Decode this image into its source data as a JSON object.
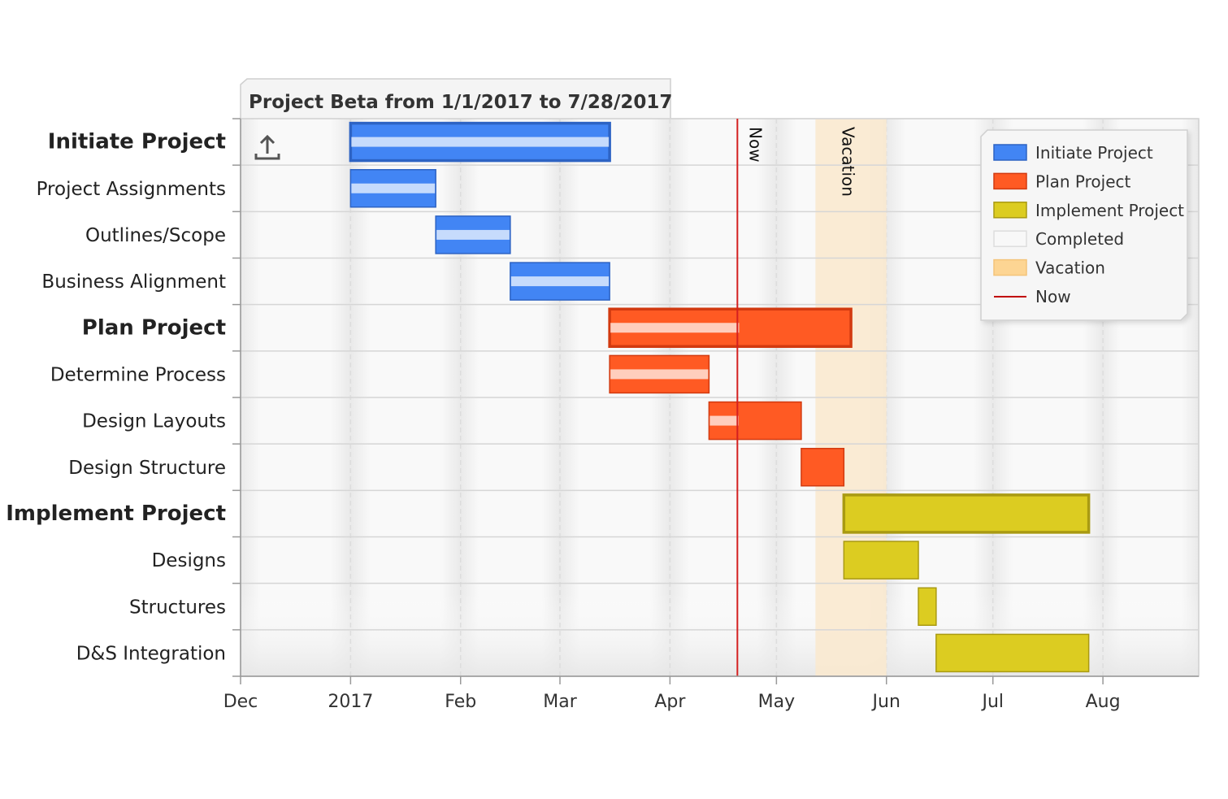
{
  "chart_data": {
    "type": "gantt",
    "title": "Project Beta from 1/1/2017 to 7/28/2017",
    "x_axis": {
      "type": "date",
      "range": [
        "2016-12-01",
        "2017-08-28"
      ],
      "ticks": [
        {
          "date": "2016-12-01",
          "label": "Dec"
        },
        {
          "date": "2017-01-01",
          "label": "2017"
        },
        {
          "date": "2017-02-01",
          "label": "Feb"
        },
        {
          "date": "2017-03-01",
          "label": "Mar"
        },
        {
          "date": "2017-04-01",
          "label": "Apr"
        },
        {
          "date": "2017-05-01",
          "label": "May"
        },
        {
          "date": "2017-06-01",
          "label": "Jun"
        },
        {
          "date": "2017-07-01",
          "label": "Jul"
        },
        {
          "date": "2017-08-01",
          "label": "Aug"
        }
      ],
      "grid": true
    },
    "tasks": [
      {
        "name": "Initiate Project",
        "group": true,
        "series": "Initiate Project",
        "start": "2017-01-01",
        "end": "2017-03-15",
        "completed": 1.0
      },
      {
        "name": "Project Assignments",
        "group": false,
        "series": "Initiate Project",
        "start": "2017-01-01",
        "end": "2017-01-25",
        "completed": 1.0
      },
      {
        "name": "Outlines/Scope",
        "group": false,
        "series": "Initiate Project",
        "start": "2017-01-25",
        "end": "2017-02-15",
        "completed": 1.0
      },
      {
        "name": "Business Alignment",
        "group": false,
        "series": "Initiate Project",
        "start": "2017-02-15",
        "end": "2017-03-15",
        "completed": 1.0
      },
      {
        "name": "Plan Project",
        "group": true,
        "series": "Plan Project",
        "start": "2017-03-15",
        "end": "2017-05-22",
        "completed": 0.54
      },
      {
        "name": "Determine Process",
        "group": false,
        "series": "Plan Project",
        "start": "2017-03-15",
        "end": "2017-04-12",
        "completed": 1.0
      },
      {
        "name": "Design Layouts",
        "group": false,
        "series": "Plan Project",
        "start": "2017-04-12",
        "end": "2017-05-08",
        "completed": 0.33
      },
      {
        "name": "Design Structure",
        "group": false,
        "series": "Plan Project",
        "start": "2017-05-08",
        "end": "2017-05-20",
        "completed": 0
      },
      {
        "name": "Implement Project",
        "group": true,
        "series": "Implement Project",
        "start": "2017-05-20",
        "end": "2017-07-28",
        "completed": 0
      },
      {
        "name": "Designs",
        "group": false,
        "series": "Implement Project",
        "start": "2017-05-20",
        "end": "2017-06-10",
        "completed": 0
      },
      {
        "name": "Structures",
        "group": false,
        "series": "Implement Project",
        "start": "2017-06-10",
        "end": "2017-06-15",
        "completed": 0
      },
      {
        "name": "D&S Integration",
        "group": false,
        "series": "Implement Project",
        "start": "2017-06-15",
        "end": "2017-07-28",
        "completed": 0
      }
    ],
    "markers": [
      {
        "name": "Now",
        "type": "line",
        "date": "2017-04-20"
      },
      {
        "name": "Vacation",
        "type": "range",
        "start": "2017-05-12",
        "end": "2017-06-01"
      }
    ],
    "legend": {
      "position": "top-right",
      "items": [
        {
          "name": "Initiate Project",
          "kind": "box",
          "fill": "#4285F4",
          "stroke": "#2D63C4"
        },
        {
          "name": "Plan Project",
          "kind": "box",
          "fill": "#FF5A23",
          "stroke": "#D23A10"
        },
        {
          "name": "Implement Project",
          "kind": "box",
          "fill": "#DCCC21",
          "stroke": "#A99A12"
        },
        {
          "name": "Completed",
          "kind": "box",
          "fill": "#F8F8F8",
          "stroke": "#DDDDDD"
        },
        {
          "name": "Vacation",
          "kind": "box",
          "fill": "#FDD593",
          "stroke": "#F4C47A"
        },
        {
          "name": "Now",
          "kind": "line",
          "stroke": "#C00000"
        }
      ]
    },
    "colors": {
      "Initiate Project": "#4285F4",
      "Plan Project": "#FF5A23",
      "Implement Project": "#DCCC21",
      "completed_overlay": "#FFFFFF",
      "vacation_band": "#F9E9CF",
      "now_line": "#D42020",
      "grid": "#DDDDDD",
      "plot_background": "#F7F7F7"
    }
  },
  "toolbar": {
    "export_icon": "export-upload-icon"
  }
}
